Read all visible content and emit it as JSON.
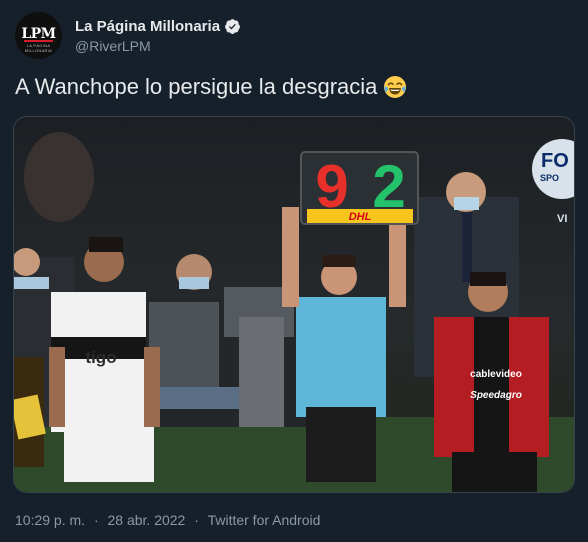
{
  "author": {
    "display_name": "La Página Millonaria",
    "handle": "@RiverLPM",
    "avatar_text": "LPM",
    "avatar_subtext": "LA PÁGINA MILLONARIA"
  },
  "tweet": {
    "text": "A Wanchope lo persigue la desgracia"
  },
  "media": {
    "board_numbers": [
      "9",
      "2"
    ],
    "board_sponsor": "DHL",
    "broadcaster": "FOX SPORTS",
    "shirt_sponsor_left": "tigo",
    "shirt_sponsor_right_1": "cablevideo",
    "shirt_sponsor_right_2": "Speedagro"
  },
  "footer": {
    "time": "10:29 p. m.",
    "sep1": "·",
    "date": "28 abr. 2022",
    "sep2": "·",
    "source": "Twitter for Android"
  },
  "colors": {
    "background": "#15202b",
    "text": "#e7e9ea",
    "secondary_text": "#8b98a5",
    "verified": "#1d9bf0"
  }
}
